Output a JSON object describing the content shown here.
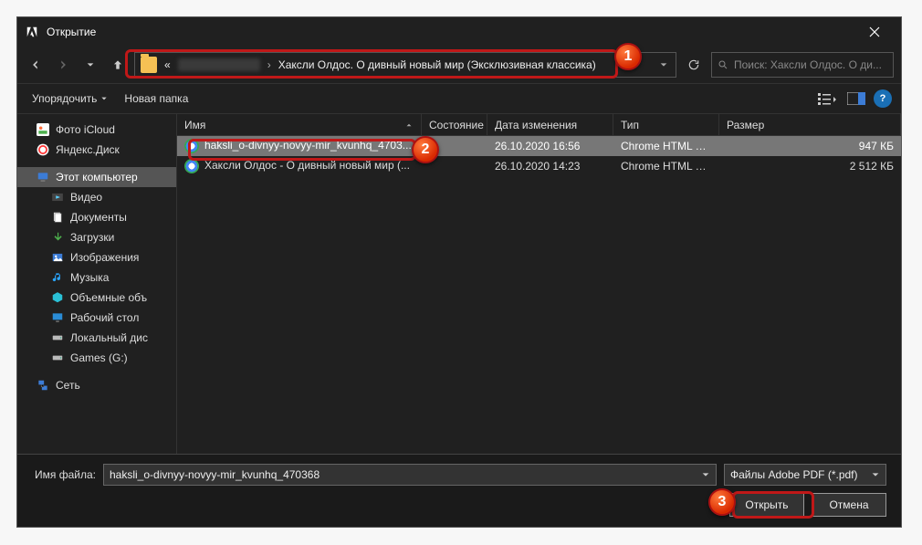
{
  "window": {
    "title": "Открытие"
  },
  "nav": {
    "breadcrumb_prefix": "«",
    "breadcrumb_tail": "Хаксли Олдос. О дивный новый мир (Эксклюзивная классика)",
    "search_placeholder": "Поиск: Хаксли Олдос. О ди..."
  },
  "toolbar": {
    "organize": "Упорядочить",
    "new_folder": "Новая папка"
  },
  "sidebar": {
    "icloud_photos": "Фото iCloud",
    "yandex_disk": "Яндекс.Диск",
    "this_pc": "Этот компьютер",
    "videos": "Видео",
    "documents": "Документы",
    "downloads": "Загрузки",
    "pictures": "Изображения",
    "music": "Музыка",
    "objects3d": "Объемные объ",
    "desktop": "Рабочий стол",
    "local_disk": "Локальный дис",
    "games": "Games (G:)",
    "network": "Сеть"
  },
  "columns": {
    "name": "Имя",
    "state": "Состояние",
    "date": "Дата изменения",
    "type": "Тип",
    "size": "Размер"
  },
  "files": [
    {
      "name": "haksli_o-divnyy-novyy-mir_kvunhq_4703...",
      "date": "26.10.2020 16:56",
      "type": "Chrome HTML Do...",
      "size": "947 КБ"
    },
    {
      "name": "Хаксли Олдос - О дивный новый мир (...",
      "date": "26.10.2020 14:23",
      "type": "Chrome HTML Do...",
      "size": "2 512 КБ"
    }
  ],
  "footer": {
    "filename_label": "Имя файла:",
    "filename_value": "haksli_o-divnyy-novyy-mir_kvunhq_470368",
    "filetype": "Файлы Adobe PDF (*.pdf)",
    "open": "Открыть",
    "cancel": "Отмена"
  },
  "callouts": {
    "c1": "1",
    "c2": "2",
    "c3": "3"
  }
}
